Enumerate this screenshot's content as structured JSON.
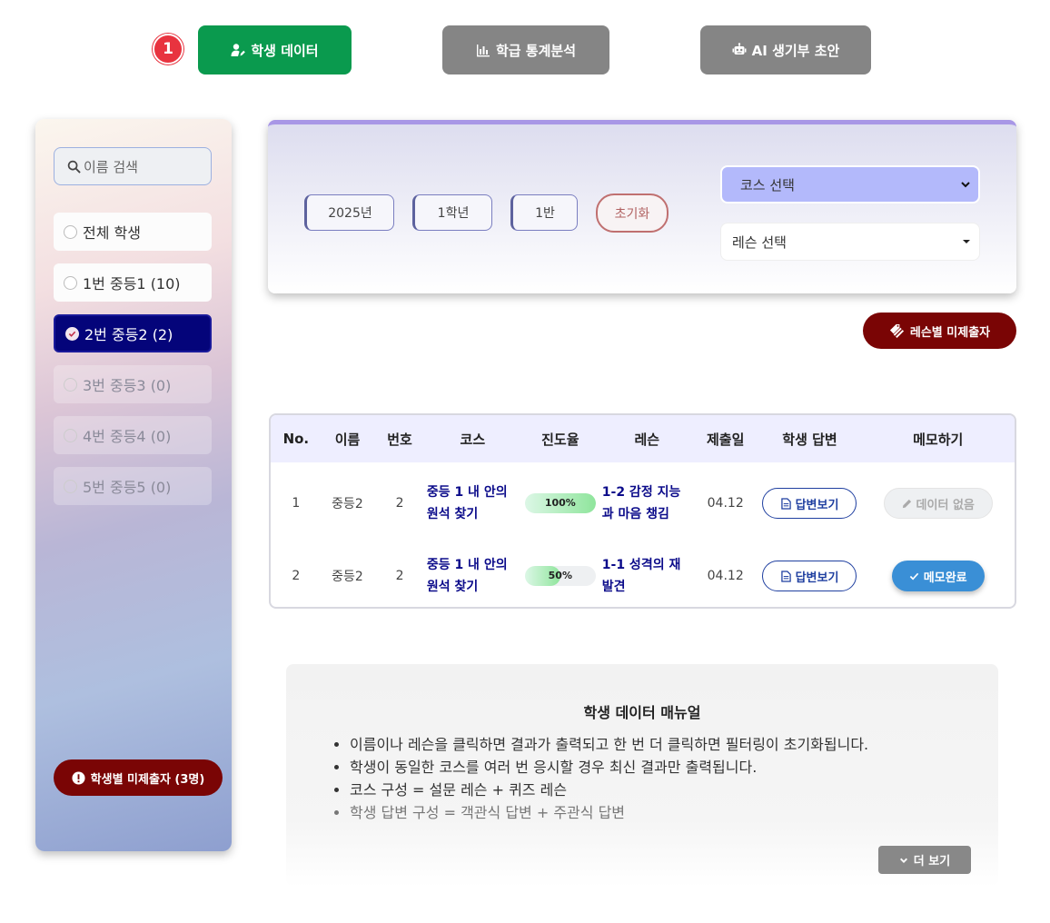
{
  "step_badge": "1",
  "nav": {
    "student_data": "학생 데이터",
    "class_stats": "학급 통계분석",
    "ai_draft": "AI 생기부 초안"
  },
  "sidebar": {
    "search_placeholder": "이름 검색",
    "items": [
      {
        "label": "전체 학생",
        "state": "normal"
      },
      {
        "label": "1번 중등1 (10)",
        "state": "normal"
      },
      {
        "label": "2번 중등2 (2)",
        "state": "selected"
      },
      {
        "label": "3번 중등3 (0)",
        "state": "disabled"
      },
      {
        "label": "4번 중등4 (0)",
        "state": "disabled"
      },
      {
        "label": "5번 중등5 (0)",
        "state": "disabled"
      }
    ],
    "missing_button": "학생별 미제출자 (3명)"
  },
  "filters": {
    "year": "2025년",
    "grade": "1학년",
    "class": "1반",
    "reset": "초기화",
    "course_select": "코스 선택",
    "lesson_select": "레슨 선택"
  },
  "lesson_missing_button": "레슨별 미제출자",
  "table": {
    "headers": [
      "No.",
      "이름",
      "번호",
      "코스",
      "진도율",
      "레슨",
      "제출일",
      "학생 답변",
      "메모하기"
    ],
    "rows": [
      {
        "no": "1",
        "name": "중등2",
        "number": "2",
        "course": "중등 1 내 안의 원석 찾기",
        "progress_label": "100%",
        "progress": 100,
        "lesson": "1-2 감정 지능과 마음 챙김",
        "date": "04.12",
        "answer": "답변보기",
        "memo": "데이터 없음",
        "memo_state": "none"
      },
      {
        "no": "2",
        "name": "중등2",
        "number": "2",
        "course": "중등 1 내 안의 원석 찾기",
        "progress_label": "50%",
        "progress": 50,
        "lesson": "1-1 성격의 재발견",
        "date": "04.12",
        "answer": "답변보기",
        "memo": "메모완료",
        "memo_state": "done"
      }
    ]
  },
  "manual": {
    "title": "학생 데이터 매뉴얼",
    "items": [
      "이름이나 레슨을 클릭하면 결과가 출력되고 한 번 더 클릭하면 필터링이 초기화됩니다.",
      "학생이 동일한 코스를 여러 번 응시할 경우 최신 결과만 출력됩니다.",
      "코스 구성 = 설문 레슨 + 퀴즈 레슨",
      "학생 답변 구성 = 객관식 답변 + 주관식 답변"
    ],
    "more": "더 보기"
  },
  "colors": {
    "active_green": "#0a9a4e",
    "inactive_gray": "#858585",
    "selected_navy": "#04047a",
    "missing_red": "#7a0505",
    "link_navy": "#0b0b8a",
    "memo_blue": "#3a8fd6"
  }
}
